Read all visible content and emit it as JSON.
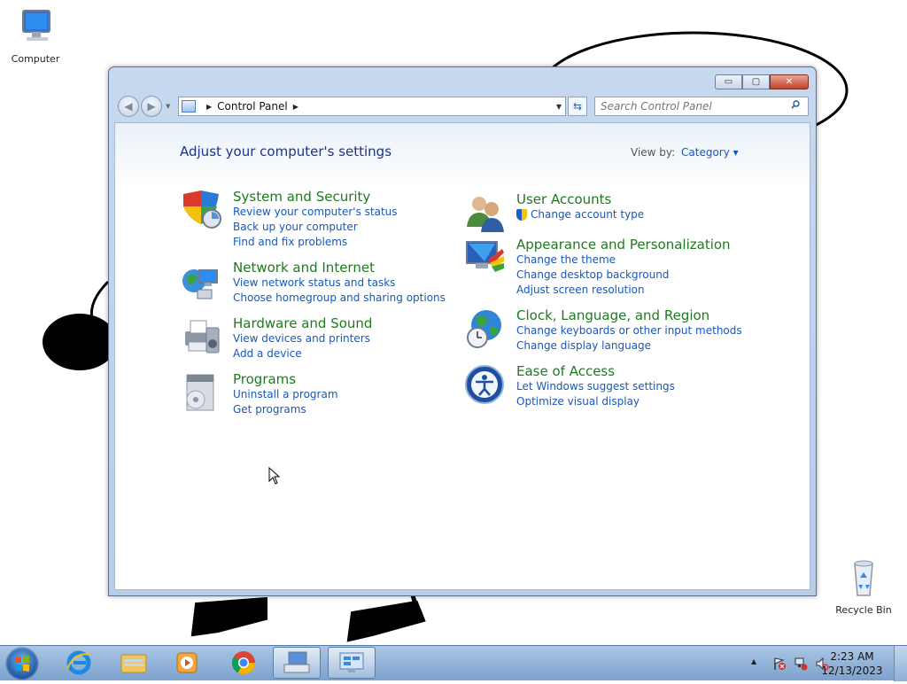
{
  "desktop": {
    "icons": [
      {
        "label": "Computer"
      },
      {
        "label": "Recycle Bin"
      }
    ]
  },
  "window": {
    "buttons": {
      "minimize": "▭",
      "maximize": "▢",
      "close": "✕"
    },
    "address": {
      "crumb": "Control Panel"
    },
    "search": {
      "placeholder": "Search Control Panel"
    },
    "heading": "Adjust your computer's settings",
    "view_by": {
      "label": "View by:",
      "value": "Category ▾"
    },
    "categories_left": [
      {
        "title": "System and Security",
        "links": [
          "Review your computer's status",
          "Back up your computer",
          "Find and fix problems"
        ],
        "icon": "shield-icon"
      },
      {
        "title": "Network and Internet",
        "links": [
          "View network status and tasks",
          "Choose homegroup and sharing options"
        ],
        "icon": "network-icon"
      },
      {
        "title": "Hardware and Sound",
        "links": [
          "View devices and printers",
          "Add a device"
        ],
        "icon": "printer-icon"
      },
      {
        "title": "Programs",
        "links": [
          "Uninstall a program",
          "Get programs"
        ],
        "icon": "programs-icon"
      }
    ],
    "categories_right": [
      {
        "title": "User Accounts",
        "links": [
          "Change account type"
        ],
        "icon": "users-icon"
      },
      {
        "title": "Appearance and Personalization",
        "links": [
          "Change the theme",
          "Change desktop background",
          "Adjust screen resolution"
        ],
        "icon": "appearance-icon"
      },
      {
        "title": "Clock, Language, and Region",
        "links": [
          "Change keyboards or other input methods",
          "Change display language"
        ],
        "icon": "globe-clock-icon"
      },
      {
        "title": "Ease of Access",
        "links": [
          "Let Windows suggest settings",
          "Optimize visual display"
        ],
        "icon": "ease-of-access-icon"
      }
    ]
  },
  "taskbar": {
    "items": [
      "start-button",
      "internet-explorer",
      "file-explorer",
      "media-player",
      "chrome",
      "on-screen-keyboard",
      "control-panel"
    ],
    "clock": {
      "time": "2:23 AM",
      "date": "12/13/2023"
    },
    "tray_expand": "▲"
  }
}
